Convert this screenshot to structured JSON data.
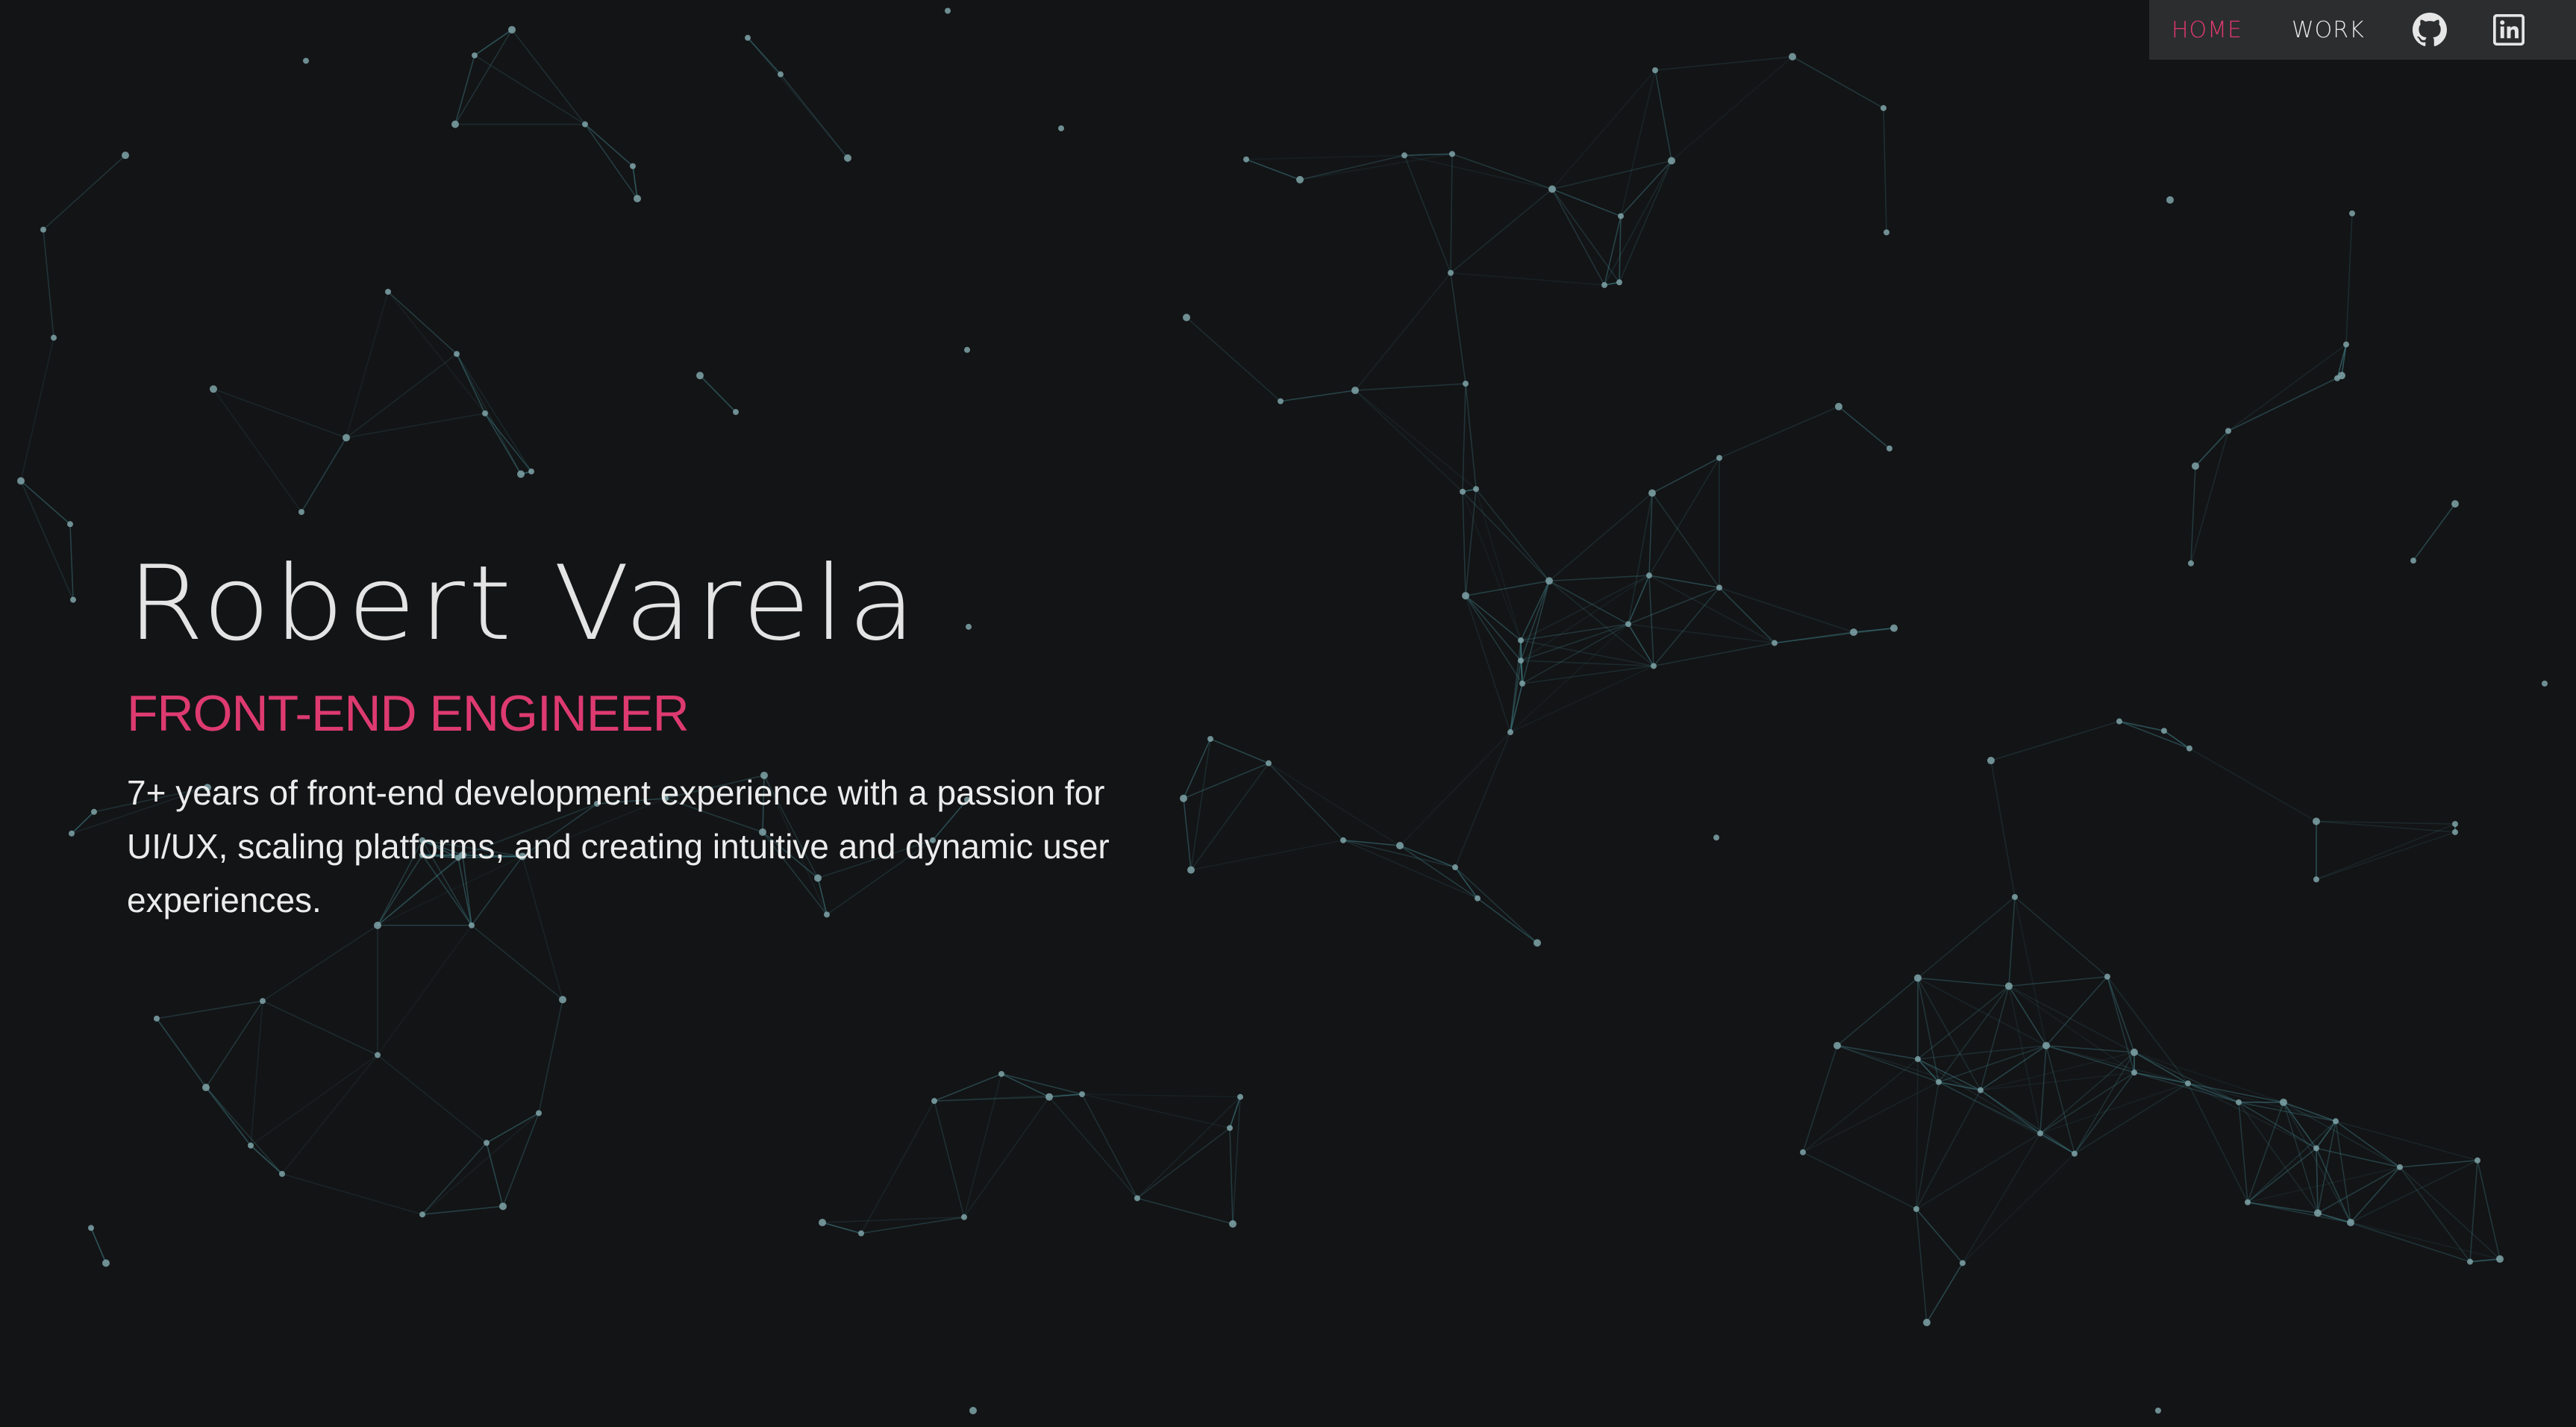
{
  "nav": {
    "home_label": "HOME",
    "work_label": "WORK",
    "github_icon": "github-icon",
    "linkedin_icon": "linkedin-icon"
  },
  "hero": {
    "name": "Robert Varela",
    "role": "FRONT-END ENGINEER",
    "description": "7+ years of front-end development experience with a passion for UI/UX, scaling platforms, and creating intuitive and dynamic user experiences."
  },
  "theme": {
    "background": "#131416",
    "accent": "#dd3a70",
    "nav_background": "#2c2d2f",
    "particle_color": "#7fa3a8",
    "line_color": "#3f7f86"
  }
}
